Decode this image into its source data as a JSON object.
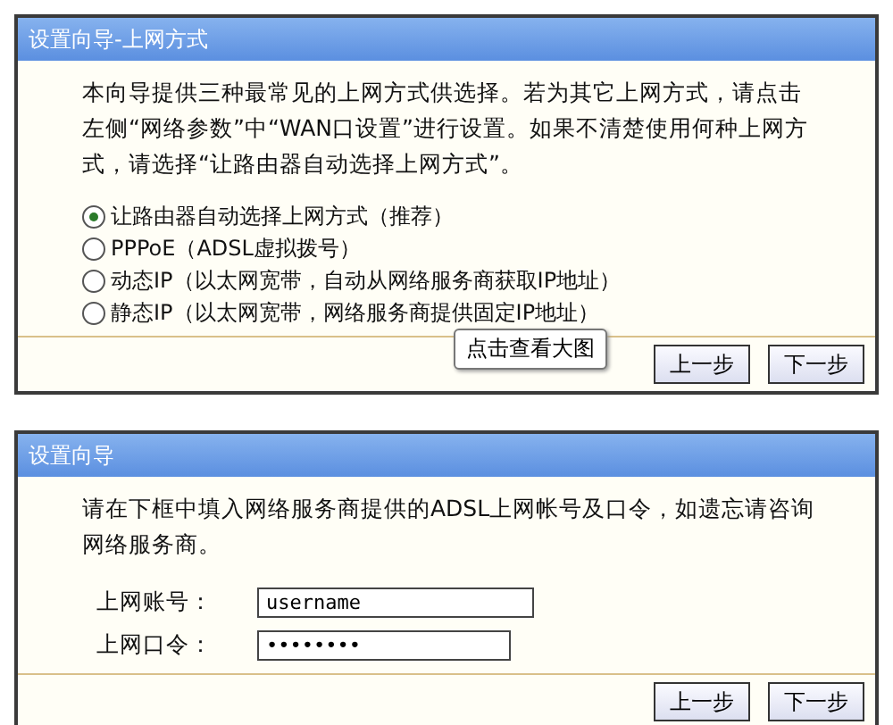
{
  "panels": [
    {
      "kind": "options",
      "title": "设置向导-上网方式",
      "description": "本向导提供三种最常见的上网方式供选择。若为其它上网方式，请点击左侧“网络参数”中“WAN口设置”进行设置。如果不清楚使用何种上网方式，请选择“让路由器自动选择上网方式”。",
      "options": [
        {
          "label": "让路由器自动选择上网方式（推荐）",
          "selected": true
        },
        {
          "label": "PPPoE（ADSL虚拟拨号）",
          "selected": false
        },
        {
          "label": "动态IP（以太网宽带，自动从网络服务商获取IP地址）",
          "selected": false
        },
        {
          "label": "静态IP（以太网宽带，网络服务商提供固定IP地址）",
          "selected": false
        }
      ],
      "tooltip": "点击查看大图",
      "buttons": [
        "上一步",
        "下一步"
      ]
    },
    {
      "kind": "account",
      "title": "设置向导",
      "description": "请在下框中填入网络服务商提供的ADSL上网帐号及口令，如遗忘请咨询网络服务商。",
      "fields": [
        {
          "label": "上网账号：",
          "value": "username",
          "wide": true
        },
        {
          "label": "上网口令：",
          "value": "••••••••",
          "wide": false
        }
      ],
      "buttons": [
        "上一步",
        "下一步"
      ]
    }
  ]
}
